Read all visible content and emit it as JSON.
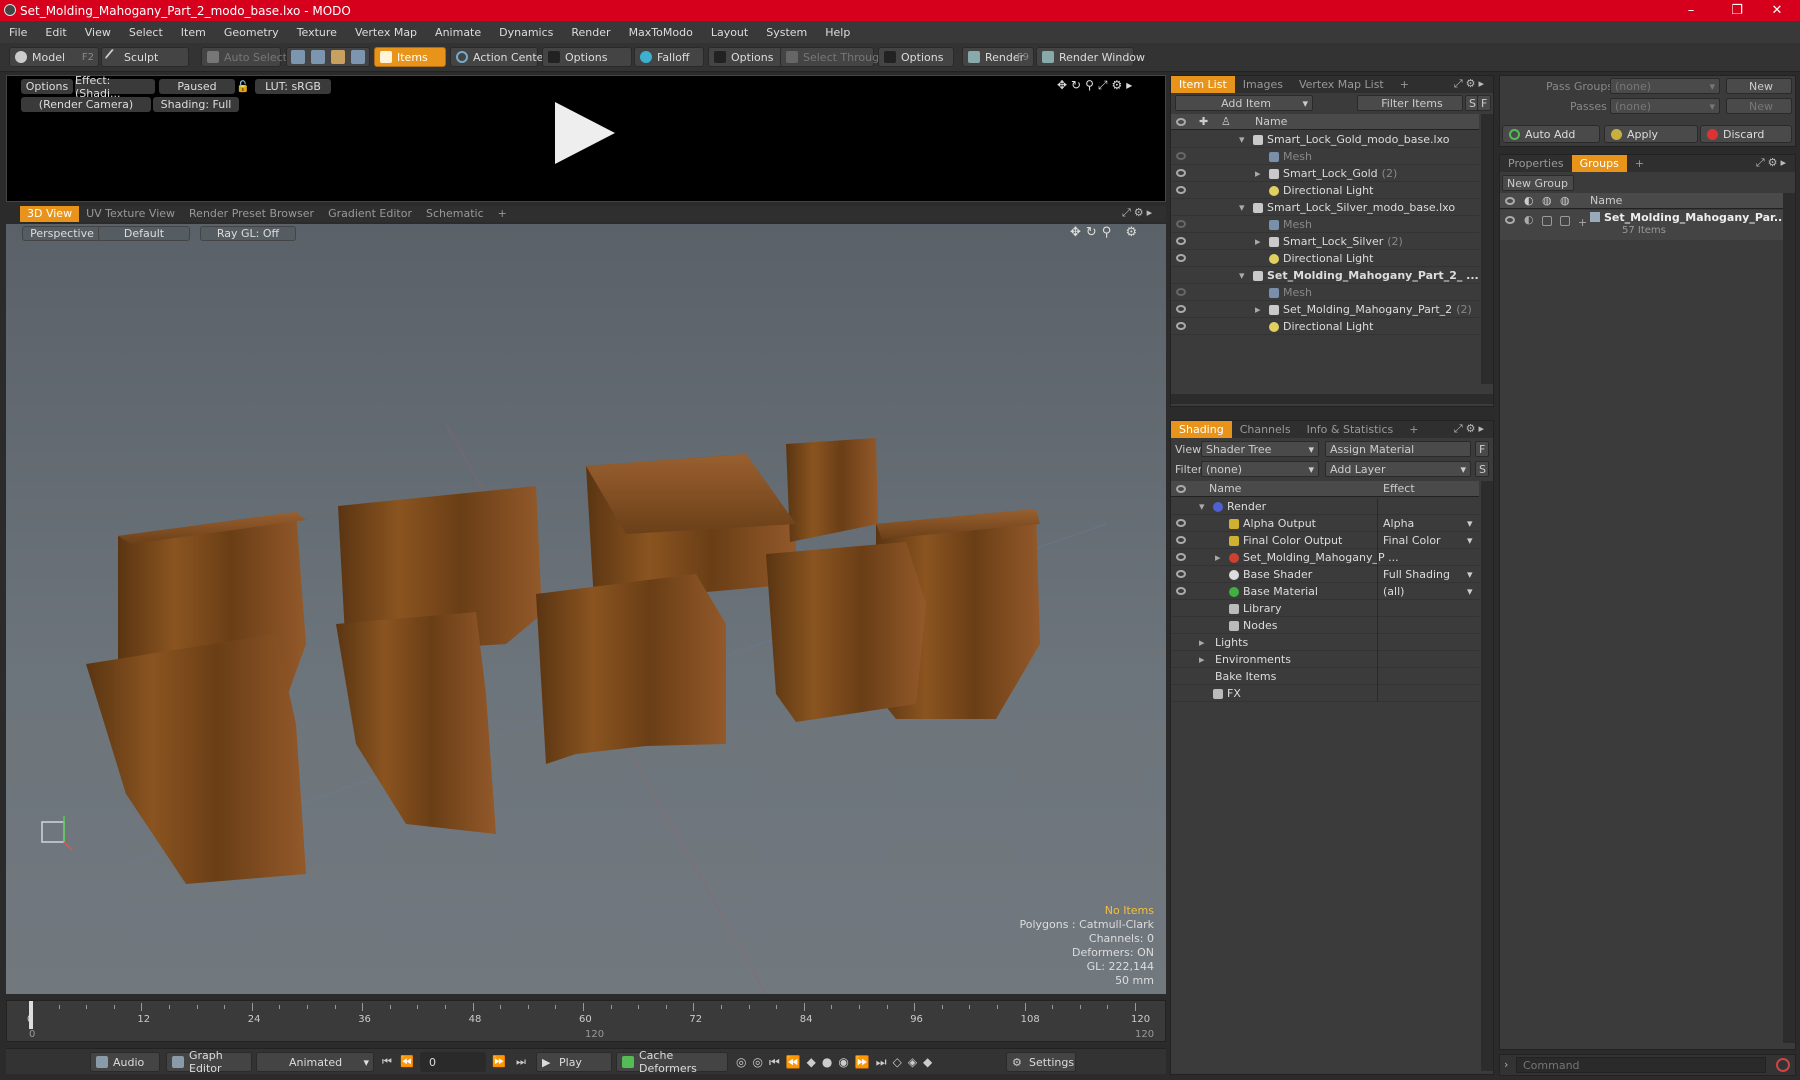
{
  "window": {
    "title": "Set_Molding_Mahogany_Part_2_modo_base.lxo - MODO",
    "minimize": "–",
    "maximize": "❐",
    "close": "✕"
  },
  "menu": [
    "File",
    "Edit",
    "View",
    "Select",
    "Item",
    "Geometry",
    "Texture",
    "Vertex Map",
    "Animate",
    "Dynamics",
    "Render",
    "MaxToModo",
    "Layout",
    "System",
    "Help"
  ],
  "toolbar": {
    "model": "Model",
    "model_key": "F2",
    "sculpt": "Sculpt",
    "auto_select": "Auto Select",
    "items": "Items",
    "action_center": "Action Center",
    "options1": "Options",
    "falloff": "Falloff",
    "options2": "Options",
    "select_through": "Select Through",
    "options3": "Options",
    "render": "Render",
    "render_key": "F9",
    "render_window": "Render Window"
  },
  "preview": {
    "options": "Options",
    "effect": "Effect: (Shadi...",
    "paused": "Paused",
    "lut": "LUT: sRGB",
    "camera": "(Render Camera)",
    "shading": "Shading: Full"
  },
  "view_tabs": [
    "3D View",
    "UV Texture View",
    "Render Preset Browser",
    "Gradient Editor",
    "Schematic",
    "+"
  ],
  "viewport": {
    "projection": "Perspective",
    "style": "Default",
    "raygl": "Ray GL: Off"
  },
  "stats": {
    "no_items": "No Items",
    "polygons": "Polygons : Catmull-Clark",
    "channels": "Channels: 0",
    "deformers": "Deformers: ON",
    "gl": "GL: 222,144",
    "scale": "50 mm"
  },
  "timeline": {
    "ticks": [
      "0",
      "12",
      "24",
      "36",
      "48",
      "60",
      "72",
      "84",
      "96",
      "108",
      "120"
    ],
    "start": "0",
    "mid": "120",
    "end": "120"
  },
  "bottom": {
    "audio": "Audio",
    "graph_editor": "Graph Editor",
    "animated": "Animated",
    "frame": "0",
    "play": "Play",
    "cache_deformers": "Cache Deformers",
    "settings": "Settings"
  },
  "item_list": {
    "tabs": [
      "Item List",
      "Images",
      "Vertex Map List",
      "+"
    ],
    "add_item": "Add Item",
    "filter_items": "Filter Items",
    "s_btn": "S",
    "f_btn": "F",
    "col_name": "Name",
    "rows": [
      {
        "label": "Smart_Lock_Gold_modo_base.lxo",
        "count": "",
        "level": 0,
        "kind": "scene",
        "dim": false
      },
      {
        "label": "Mesh",
        "count": "",
        "level": 1,
        "kind": "mesh",
        "dim": true
      },
      {
        "label": "Smart_Lock_Gold",
        "count": "(2)",
        "level": 1,
        "kind": "group",
        "dim": false
      },
      {
        "label": "Directional Light",
        "count": "",
        "level": 1,
        "kind": "light",
        "dim": false
      },
      {
        "label": "Smart_Lock_Silver_modo_base.lxo",
        "count": "",
        "level": 0,
        "kind": "scene",
        "dim": false
      },
      {
        "label": "Mesh",
        "count": "",
        "level": 1,
        "kind": "mesh",
        "dim": true
      },
      {
        "label": "Smart_Lock_Silver",
        "count": "(2)",
        "level": 1,
        "kind": "group",
        "dim": false
      },
      {
        "label": "Directional Light",
        "count": "",
        "level": 1,
        "kind": "light",
        "dim": false
      },
      {
        "label": "Set_Molding_Mahogany_Part_2_ ...",
        "count": "",
        "level": 0,
        "kind": "scene",
        "dim": false
      },
      {
        "label": "Mesh",
        "count": "",
        "level": 1,
        "kind": "mesh",
        "dim": true
      },
      {
        "label": "Set_Molding_Mahogany_Part_2",
        "count": "(2)",
        "level": 1,
        "kind": "group",
        "dim": false
      },
      {
        "label": "Directional Light",
        "count": "",
        "level": 1,
        "kind": "light",
        "dim": false
      }
    ]
  },
  "shading": {
    "tabs": [
      "Shading",
      "Channels",
      "Info & Statistics",
      "+"
    ],
    "view_label": "View",
    "view_value": "Shader Tree",
    "assign_material": "Assign Material",
    "filter_label": "Filter",
    "filter_value": "(none)",
    "add_layer": "Add Layer",
    "f_btn": "F",
    "s_btn": "S",
    "col_name": "Name",
    "col_effect": "Effect",
    "rows": [
      {
        "label": "Render",
        "effect": "",
        "level": 0,
        "kind": "render"
      },
      {
        "label": "Alpha Output",
        "effect": "Alpha",
        "level": 1,
        "kind": "output"
      },
      {
        "label": "Final Color Output",
        "effect": "Final Color",
        "level": 1,
        "kind": "output"
      },
      {
        "label": "Set_Molding_Mahogany_P ...",
        "effect": "",
        "level": 1,
        "kind": "material"
      },
      {
        "label": "Base Shader",
        "effect": "Full Shading",
        "level": 1,
        "kind": "shader"
      },
      {
        "label": "Base Material",
        "effect": "(all)",
        "level": 1,
        "kind": "basemat"
      },
      {
        "label": "Library",
        "effect": "",
        "level": 1,
        "kind": "folder"
      },
      {
        "label": "Nodes",
        "effect": "",
        "level": 1,
        "kind": "folder"
      },
      {
        "label": "Lights",
        "effect": "",
        "level": 0,
        "kind": "none"
      },
      {
        "label": "Environments",
        "effect": "",
        "level": 0,
        "kind": "none"
      },
      {
        "label": "Bake Items",
        "effect": "",
        "level": 0,
        "kind": "none"
      },
      {
        "label": "FX",
        "effect": "",
        "level": 0,
        "kind": "fx"
      }
    ]
  },
  "passes": {
    "pass_groups": "Pass Groups",
    "pass_groups_value": "(none)",
    "new1": "New",
    "passes": "Passes",
    "passes_value": "(none)",
    "new2": "New",
    "auto_add": "Auto Add",
    "apply": "Apply",
    "discard": "Discard"
  },
  "groups": {
    "tabs": [
      "Properties",
      "Groups",
      "+"
    ],
    "new_group": "New Group",
    "col_name": "Name",
    "group_name": "Set_Molding_Mahogany_Par...",
    "group_count": "57 Items"
  },
  "command": {
    "placeholder": "Command"
  }
}
